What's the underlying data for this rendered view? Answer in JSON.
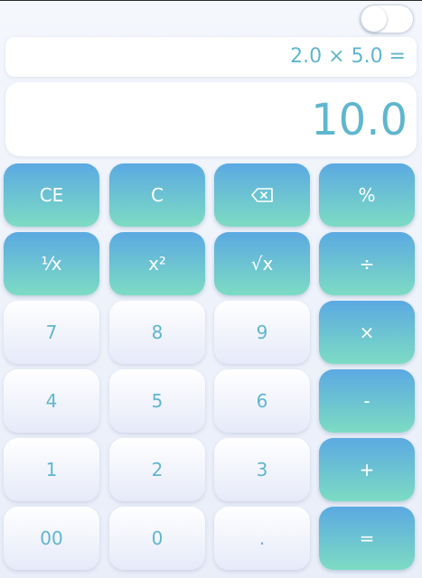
{
  "theme": {
    "accent_gradient": [
      "#5ba9e2",
      "#7ddcc3"
    ],
    "display_text_color": "#5fb6cf",
    "key_light": "#ffffff"
  },
  "toggle": {
    "state": "off"
  },
  "display": {
    "expression": "2.0 × 5.0 =",
    "result": "10.0"
  },
  "keys": {
    "ce": "CE",
    "c": "C",
    "backspace_icon": "backspace-icon",
    "percent": "%",
    "reciprocal": "⅟x",
    "square": "x²",
    "sqrt": "√x",
    "divide": "÷",
    "seven": "7",
    "eight": "8",
    "nine": "9",
    "multiply": "×",
    "four": "4",
    "five": "5",
    "six": "6",
    "minus": "-",
    "one": "1",
    "two": "2",
    "three": "3",
    "plus": "+",
    "double_zero": "00",
    "zero": "0",
    "decimal": ".",
    "equals": "="
  }
}
